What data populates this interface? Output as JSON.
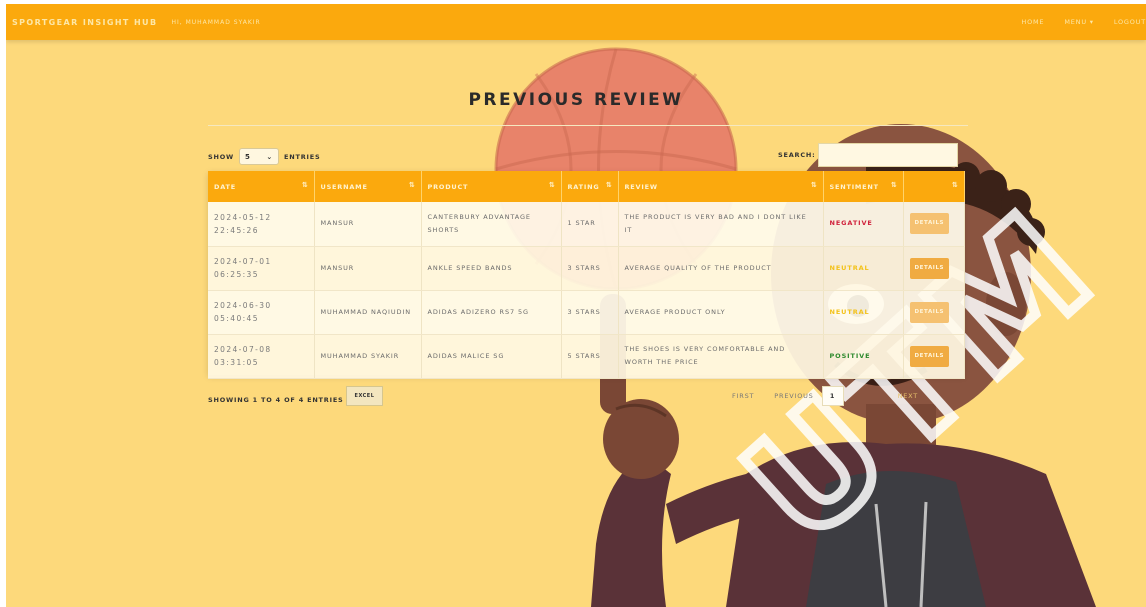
{
  "navbar": {
    "brand": "SPORTGEAR INSIGHT HUB",
    "greeting": "HI, MUHAMMAD SYAKIR",
    "links": {
      "home": "HOME",
      "menu": "MENU ▾",
      "logout": "LOGOUT"
    }
  },
  "page": {
    "title": "PREVIOUS REVIEW"
  },
  "controls": {
    "show_label": "SHOW",
    "show_value": "5",
    "entries_label": "ENTRIES",
    "search_label": "SEARCH:",
    "search_value": ""
  },
  "table": {
    "columns": {
      "date": "DATE",
      "username": "USERNAME",
      "product": "PRODUCT",
      "rating": "RATING",
      "review": "REVIEW",
      "sentiment": "SENTIMENT",
      "action": ""
    },
    "rows": [
      {
        "date_day": "2024-05-12",
        "date_time": "22:45:26",
        "username": "MANSUR",
        "product": "CANTERBURY ADVANTAGE SHORTS",
        "rating": "1 STAR",
        "review": "THE PRODUCT IS VERY BAD AND I DONT LIKE IT",
        "sentiment": "NEGATIVE",
        "action": "DETAILS"
      },
      {
        "date_day": "2024-07-01",
        "date_time": "06:25:35",
        "username": "MANSUR",
        "product": "ANKLE SPEED BANDS",
        "rating": "3 STARS",
        "review": "AVERAGE QUALITY OF THE PRODUCT",
        "sentiment": "NEUTRAL",
        "action": "DETAILS"
      },
      {
        "date_day": "2024-06-30",
        "date_time": "05:40:45",
        "username": "MUHAMMAD NAQIUDIN",
        "product": "ADIDAS ADIZERO RS7 5G",
        "rating": "3 STARS",
        "review": "AVERAGE PRODUCT ONLY",
        "sentiment": "NEUTRAL",
        "action": "DETAILS"
      },
      {
        "date_day": "2024-07-08",
        "date_time": "03:31:05",
        "username": "MUHAMMAD SYAKIR",
        "product": "ADIDAS MALICE SG",
        "rating": "5 STARS",
        "review": "THE SHOES IS VERY COMFORTABLE AND WORTH THE PRICE",
        "sentiment": "POSITIVE",
        "action": "DETAILS"
      }
    ]
  },
  "footer": {
    "showing": "SHOWING 1 TO 4 OF 4 ENTRIES",
    "excel": "EXCEL",
    "first": "FIRST",
    "previous": "PREVIOUS",
    "page": "1",
    "next": "NEXT"
  },
  "watermark": "UTM",
  "colors": {
    "navbar": "#fba90d",
    "page_bg": "#fdd97b",
    "table_header": "#fba90d",
    "negative": "#d0223c",
    "neutral": "#f3c21a",
    "positive": "#2e8a2e"
  }
}
